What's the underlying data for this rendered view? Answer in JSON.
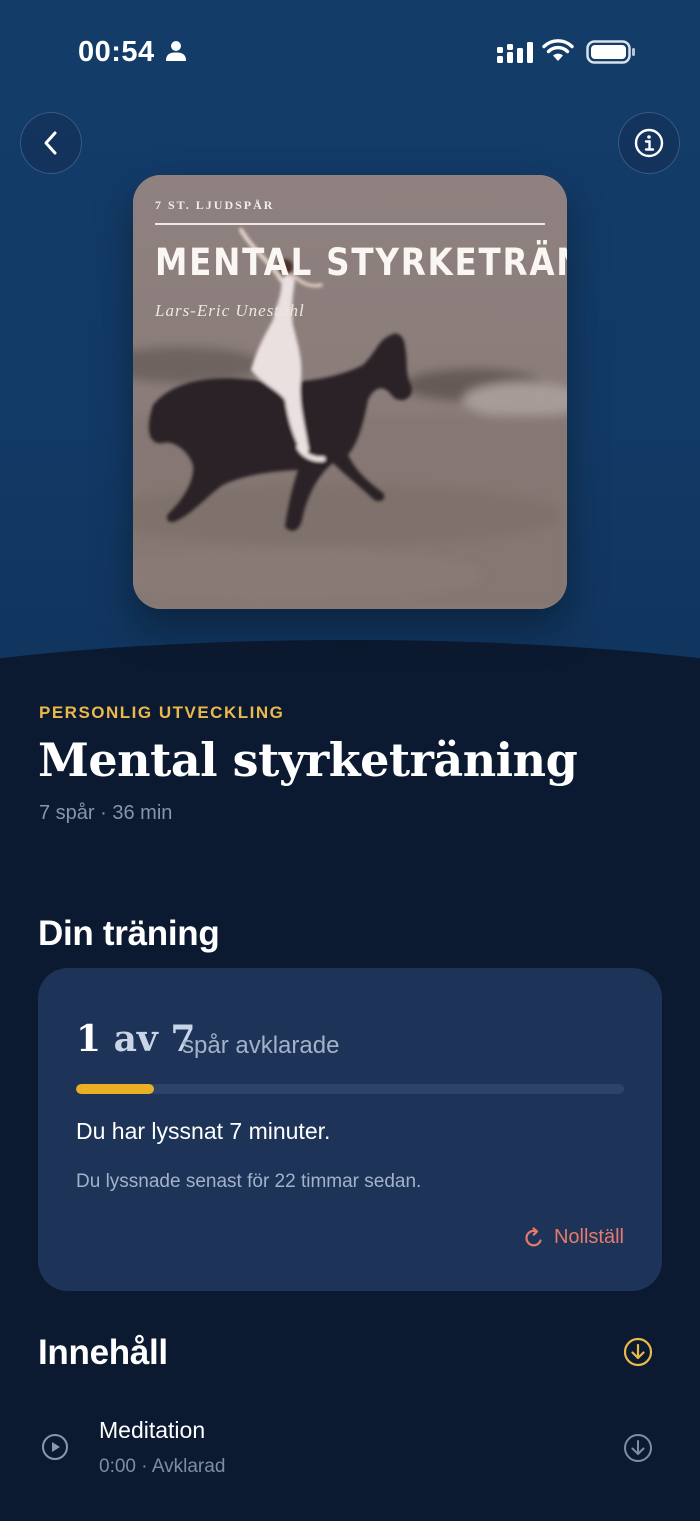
{
  "status_bar": {
    "time": "00:54",
    "icons": [
      "person-icon",
      "signal-icon",
      "wifi-icon",
      "battery-icon"
    ]
  },
  "header": {
    "back_icon": "chevron-left-icon",
    "info_icon": "info-icon"
  },
  "cover": {
    "tracks_label": "7 ST. LJUDSPÅR",
    "title": "MENTAL STYRKETRÄNING",
    "author": "Lars-Eric Uneståhl"
  },
  "program": {
    "category": "PERSONLIG UTVECKLING",
    "title": "Mental styrketräning",
    "meta": "7 spår · 36 min"
  },
  "training": {
    "heading": "Din träning",
    "completed": "1",
    "of_word": "av",
    "total": "7",
    "suffix": "spår avklarade",
    "progress_fraction": 0.1429,
    "listened_text": "Du har lyssnat 7 minuter.",
    "last_listened_text": "Du lyssnade senast för 22 timmar sedan.",
    "reset_label": "Nollställ"
  },
  "contents": {
    "heading": "Innehåll",
    "tracks": [
      {
        "title": "Meditation",
        "meta": "0:00 · Avklarad"
      }
    ]
  },
  "colors": {
    "accent_gold": "#e9b94a",
    "progress_fill": "#e9b026",
    "reset_red": "#e57a6d",
    "background": "#0c1a31",
    "card": "#1d3458"
  }
}
